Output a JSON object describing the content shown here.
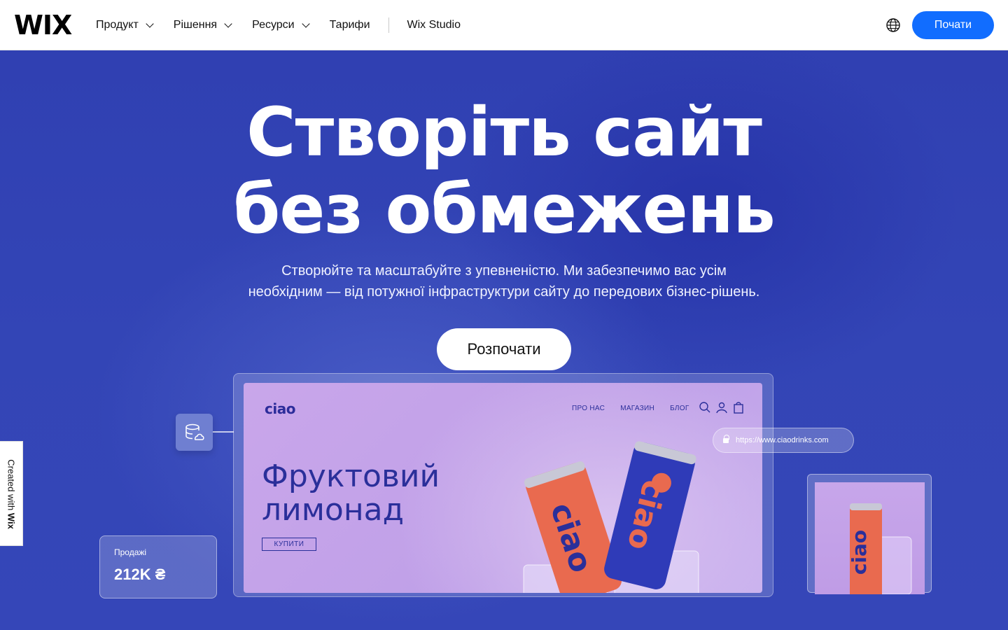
{
  "header": {
    "logo": "WIX",
    "nav": [
      {
        "label": "Продукт",
        "has_dropdown": true
      },
      {
        "label": "Рішення",
        "has_dropdown": true
      },
      {
        "label": "Ресурси",
        "has_dropdown": true
      },
      {
        "label": "Тарифи",
        "has_dropdown": false
      }
    ],
    "studio_link": "Wix Studio",
    "language_icon": "globe-icon",
    "cta_label": "Почати",
    "cta_color": "#116dff"
  },
  "hero": {
    "title_line1": "Створіть сайт",
    "title_line2": "без обмежень",
    "subtitle_line1": "Створюйте та масштабуйте з упевненістю. Ми забезпечимо вас усім",
    "subtitle_line2": "необхідним — від потужної інфраструктури сайту до передових бізнес-рішень.",
    "cta_label": "Розпочати",
    "background_color": "#3344b5"
  },
  "mockup": {
    "site_logo": "ciao",
    "site_nav": [
      "ПРО НАС",
      "МАГАЗИН",
      "БЛОГ"
    ],
    "site_icons": [
      "search-icon",
      "user-icon",
      "bag-icon"
    ],
    "site_title_line1": "Фруктовий",
    "site_title_line2": "лимонад",
    "site_buy": "КУПИТИ",
    "can_text": "ciao",
    "url": "https://www.ciaodrinks.com",
    "sales_label": "Продажі",
    "sales_value": "212K ₴"
  },
  "badge": {
    "prefix": "Created with",
    "brand": "Wix"
  }
}
